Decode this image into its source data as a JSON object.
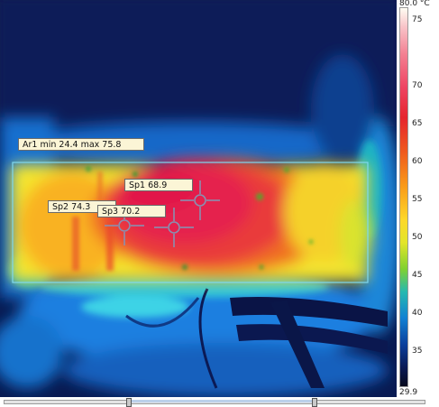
{
  "palette": {
    "max_label": "80.0 °C",
    "min_label": "29.9",
    "ticks": [
      "75",
      "70",
      "65",
      "60",
      "55",
      "50",
      "45",
      "40",
      "35"
    ]
  },
  "area_tag": {
    "label": "Ar1 min 24.4 max 75.8"
  },
  "spots": [
    {
      "label": "Sp1 68.9"
    },
    {
      "label": "Sp2 74.3"
    },
    {
      "label": "Sp3 70.2"
    }
  ],
  "colors": {
    "box_outline": "#7fd8f0",
    "tag_background": "#fbf5d6"
  }
}
